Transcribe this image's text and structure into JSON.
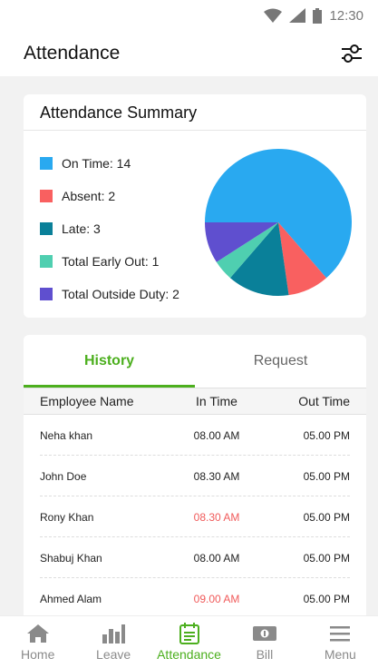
{
  "status_bar": {
    "time": "12:30"
  },
  "app_bar": {
    "title": "Attendance"
  },
  "summary": {
    "title": "Attendance Summary",
    "legend": [
      {
        "label": "On Time: 14",
        "color": "#29a9f0"
      },
      {
        "label": "Absent: 2",
        "color": "#f96060"
      },
      {
        "label": "Late: 3",
        "color": "#0a8099"
      },
      {
        "label": "Total Early Out: 1",
        "color": "#4fcfb0"
      },
      {
        "label": "Total Outside Duty: 2",
        "color": "#5f4fcf"
      }
    ]
  },
  "chart_data": {
    "type": "pie",
    "slices": [
      {
        "label": "On Time",
        "value": 14,
        "color": "#29a9f0"
      },
      {
        "label": "Absent",
        "value": 2,
        "color": "#f96060"
      },
      {
        "label": "Late",
        "value": 3,
        "color": "#0a8099"
      },
      {
        "label": "Total Early Out",
        "value": 1,
        "color": "#4fcfb0"
      },
      {
        "label": "Total Outside Duty",
        "value": 2,
        "color": "#5f4fcf"
      }
    ]
  },
  "tabs": [
    {
      "label": "History",
      "active": true
    },
    {
      "label": "Request",
      "active": false
    }
  ],
  "table": {
    "headers": [
      "Employee Name",
      "In Time",
      "Out Time"
    ],
    "rows": [
      {
        "name": "Neha khan",
        "in": "08.00 AM",
        "out": "05.00 PM",
        "late": false
      },
      {
        "name": "John Doe",
        "in": "08.30 AM",
        "out": "05.00 PM",
        "late": false
      },
      {
        "name": "Rony Khan",
        "in": "08.30 AM",
        "out": "05.00 PM",
        "late": true
      },
      {
        "name": "Shabuj Khan",
        "in": "08.00 AM",
        "out": "05.00 PM",
        "late": false
      },
      {
        "name": "Ahmed Alam",
        "in": "09.00 AM",
        "out": "05.00 PM",
        "late": true
      }
    ]
  },
  "bottom_nav": [
    {
      "label": "Home",
      "icon": "home-icon",
      "active": false
    },
    {
      "label": "Leave",
      "icon": "bar-chart-icon",
      "active": false
    },
    {
      "label": "Attendance",
      "icon": "calendar-icon",
      "active": true
    },
    {
      "label": "Bill",
      "icon": "bill-icon",
      "active": false
    },
    {
      "label": "Menu",
      "icon": "menu-icon",
      "active": false
    }
  ],
  "colors": {
    "accent": "#4caf1e",
    "late": "#f05a5a"
  }
}
